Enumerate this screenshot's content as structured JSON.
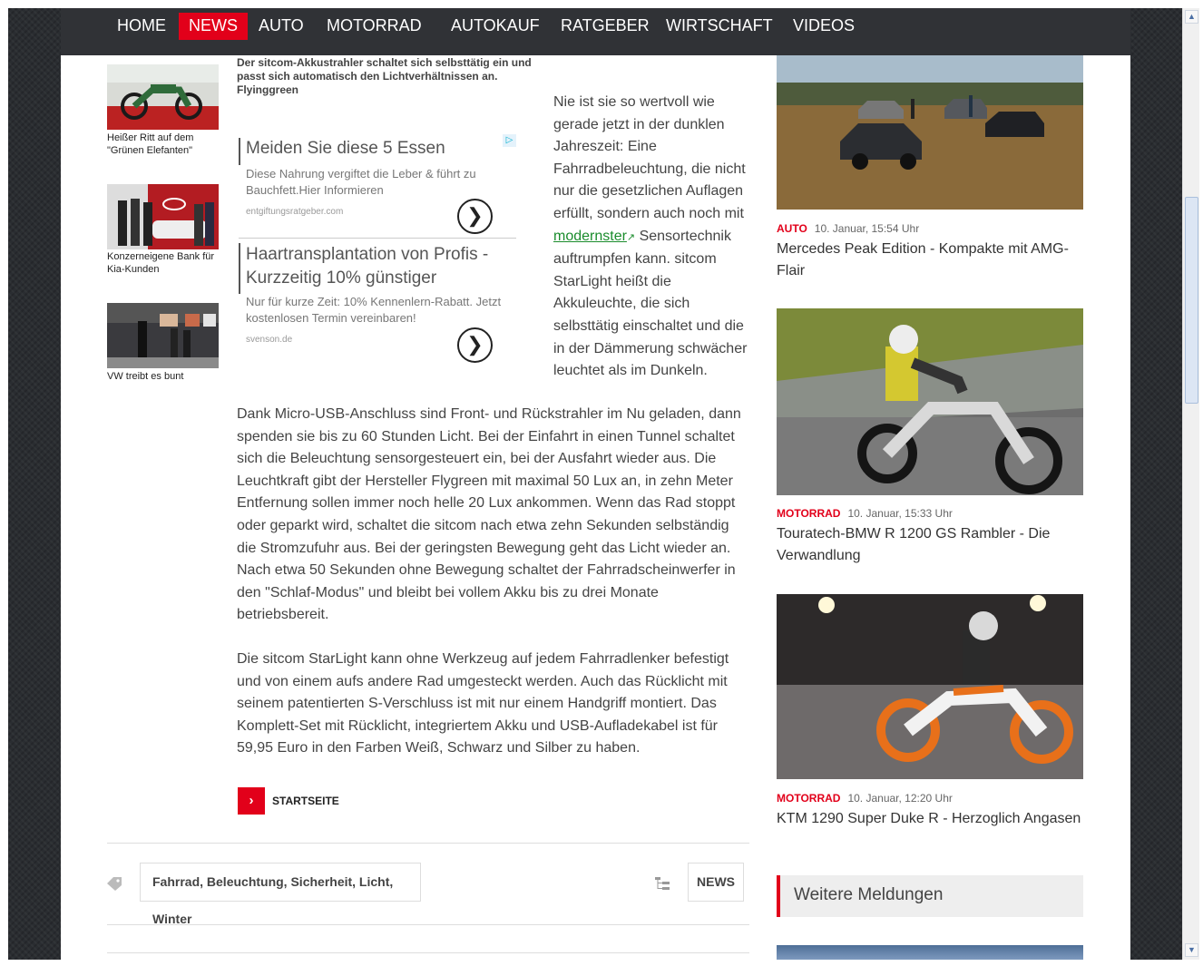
{
  "nav": {
    "items": [
      {
        "label": "HOME",
        "active": false
      },
      {
        "label": "NEWS",
        "active": true
      },
      {
        "label": "AUTO",
        "active": false
      },
      {
        "label": "MOTORRAD",
        "active": false
      },
      {
        "label": "AUTOKAUF",
        "active": false
      },
      {
        "label": "RATGEBER",
        "active": false
      },
      {
        "label": "WIRTSCHAFT",
        "active": false
      },
      {
        "label": "VIDEOS",
        "active": false
      }
    ]
  },
  "related": [
    {
      "caption": "Heißer Ritt auf dem \"Grünen Elefanten\""
    },
    {
      "caption": "Konzerneigene Bank für Kia-Kunden"
    },
    {
      "caption": "VW treibt es bunt"
    }
  ],
  "article": {
    "image_caption": "Der sitcom-Akkustrahler schaltet sich selbsttätig ein und passt sich automatisch den Lichtverhältnissen an. Flyinggreen",
    "side_text_before": "Nie ist sie so wertvoll wie gerade jetzt in der dunklen Jahreszeit: Eine Fahrradbeleuchtung, die nicht nur die gesetzlichen Auflagen erfüllt, sondern auch noch mit ",
    "side_link": "modernster",
    "side_text_after": " Sensortechnik auftrumpfen kann. sitcom StarLight heißt die Akkuleuchte, die sich selbsttätig einschaltet und die in der Dämmerung schwächer leuchtet als im Dunkeln.",
    "paragraph_1": "Dank Micro-USB-Anschluss sind Front- und Rückstrahler im Nu geladen, dann spenden sie bis zu 60 Stunden Licht. Bei der Einfahrt in einen Tunnel schaltet sich die Beleuchtung sensorgesteuert ein, bei der Ausfahrt wieder aus. Die Leuchtkraft gibt der Hersteller Flygreen mit maximal 50 Lux an, in zehn Meter Entfernung sollen immer noch helle 20 Lux ankommen. Wenn das Rad stoppt oder geparkt wird, schaltet die sitcom nach etwa zehn Sekunden selbständig die Stromzufuhr aus. Bei der geringsten Bewegung geht das Licht wieder an. Nach etwa 50 Sekunden ohne Bewegung schaltet der Fahrradscheinwerfer in den \"Schlaf-Modus\" und bleibt bei vollem Akku bis zu drei Monate betriebsbereit.",
    "paragraph_2": "Die sitcom StarLight kann ohne Werkzeug auf jedem Fahrradlenker befestigt und von einem aufs andere Rad umgesteckt werden. Auch das Rücklicht mit seinem patentierten S-Verschluss ist mit nur einem Handgriff montiert. Das Komplett-Set mit Rücklicht, integriertem Akku und USB-Aufladekabel ist für 59,95 Euro in den Farben Weiß, Schwarz und Silber zu haben.",
    "startseite_label": "STARTSEITE",
    "tags": "Fahrrad, Beleuchtung, Sicherheit, Licht, Winter",
    "category": "NEWS"
  },
  "ads": [
    {
      "title": "Meiden Sie diese 5 Essen",
      "text": "Diese Nahrung vergiftet die Leber & führt zu Bauchfett.Hier Informieren",
      "url": "entgiftungsratgeber.com",
      "arrow": "❯"
    },
    {
      "title": "Haartransplantation von Profis - Kurzzeitig 10% günstiger",
      "text": "Nur für kurze Zeit: 10% Kennenlern-Rabatt. Jetzt kostenlosen Termin vereinbaren!",
      "url": "svenson.de",
      "arrow": "❯"
    }
  ],
  "sidebar": {
    "news": [
      {
        "category": "AUTO",
        "date": "10. Januar, 15:54 Uhr",
        "title": "Mercedes Peak Edition - Kompakte mit AMG-Flair"
      },
      {
        "category": "MOTORRAD",
        "date": "10. Januar, 15:33 Uhr",
        "title": "Touratech-BMW R 1200 GS Rambler - Die Verwandlung"
      },
      {
        "category": "MOTORRAD",
        "date": "10. Januar, 12:20 Uhr",
        "title": "KTM 1290 Super Duke R - Herzoglich Angasen"
      }
    ],
    "weitere_label": "Weitere Meldungen"
  },
  "colors": {
    "accent": "#e2001a",
    "nav_bg": "#303236",
    "link_green": "#1a8c2c"
  }
}
